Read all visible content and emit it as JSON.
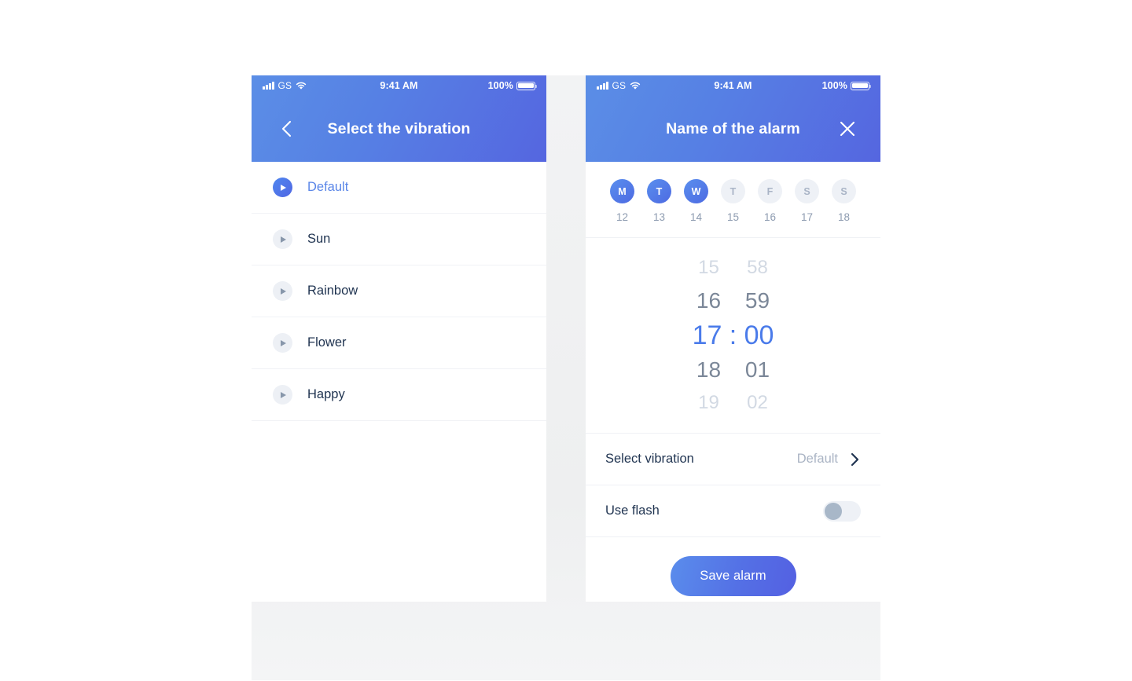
{
  "theme": {
    "accent": "#5470e5",
    "accent_light": "#5a8dec",
    "text_dark": "#1f3350",
    "text_muted": "#8d9bb0",
    "background": "#f1f2f3"
  },
  "status_bar": {
    "carrier": "GS",
    "time": "9:41 AM",
    "battery_percent": "100%",
    "signal_icon": "signal-bars-icon",
    "wifi_icon": "wifi-icon",
    "battery_icon": "battery-icon"
  },
  "left_screen": {
    "header": {
      "title": "Select the vibration",
      "back_icon": "chevron-left-icon"
    },
    "list": [
      {
        "label": "Default",
        "selected": true,
        "play_icon": "play-icon"
      },
      {
        "label": "Sun",
        "selected": false,
        "play_icon": "play-icon"
      },
      {
        "label": "Rainbow",
        "selected": false,
        "play_icon": "play-icon"
      },
      {
        "label": "Flower",
        "selected": false,
        "play_icon": "play-icon"
      },
      {
        "label": "Happy",
        "selected": false,
        "play_icon": "play-icon"
      }
    ]
  },
  "right_screen": {
    "header": {
      "title": "Name of the alarm",
      "close_icon": "close-icon"
    },
    "days": [
      {
        "letter": "M",
        "date": "12",
        "selected": true
      },
      {
        "letter": "T",
        "date": "13",
        "selected": true
      },
      {
        "letter": "W",
        "date": "14",
        "selected": true
      },
      {
        "letter": "T",
        "date": "15",
        "selected": false
      },
      {
        "letter": "F",
        "date": "16",
        "selected": false
      },
      {
        "letter": "S",
        "date": "17",
        "selected": false
      },
      {
        "letter": "S",
        "date": "18",
        "selected": false
      }
    ],
    "time_picker": {
      "rows": [
        {
          "hour": "15",
          "minute": "58",
          "state": "far"
        },
        {
          "hour": "16",
          "minute": "59",
          "state": "near"
        },
        {
          "hour": "17",
          "minute": "00",
          "state": "center"
        },
        {
          "hour": "18",
          "minute": "01",
          "state": "near"
        },
        {
          "hour": "19",
          "minute": "02",
          "state": "far"
        }
      ],
      "selected_time": "17:00",
      "separator": ":"
    },
    "settings": {
      "vibration_label": "Select vibration",
      "vibration_value": "Default",
      "vibration_chevron": "chevron-right-icon",
      "flash_label": "Use flash",
      "flash_on": false
    },
    "save_label": "Save alarm"
  }
}
